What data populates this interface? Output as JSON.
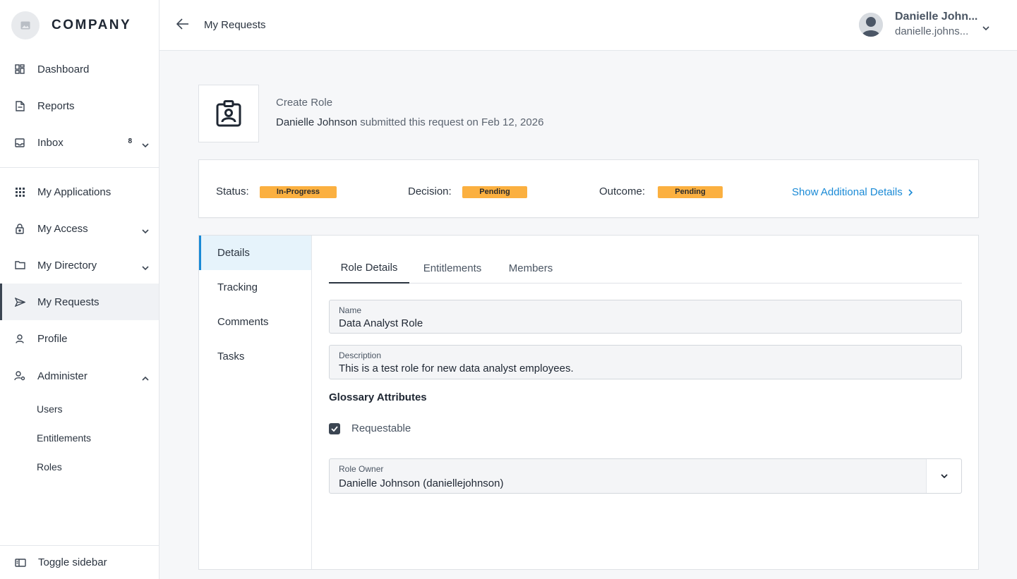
{
  "brand": {
    "name": "COMPANY"
  },
  "sidebar": {
    "items": [
      {
        "label": "Dashboard"
      },
      {
        "label": "Reports"
      },
      {
        "label": "Inbox",
        "badge": "8"
      },
      {
        "label": "My Applications"
      },
      {
        "label": "My Access"
      },
      {
        "label": "My Directory"
      },
      {
        "label": "My Requests"
      },
      {
        "label": "Profile"
      },
      {
        "label": "Administer"
      }
    ],
    "administer_sub": [
      {
        "label": "Users"
      },
      {
        "label": "Entitlements"
      },
      {
        "label": "Roles"
      }
    ],
    "toggle_label": "Toggle sidebar"
  },
  "header": {
    "title": "My Requests",
    "user_name": "Danielle John...",
    "user_email": "danielle.johns..."
  },
  "request": {
    "title": "Create Role",
    "submitter": "Danielle Johnson",
    "submitted_text": "submitted this request on Feb 12, 2026"
  },
  "status": {
    "status_label": "Status:",
    "status_value": "In-Progress",
    "decision_label": "Decision:",
    "decision_value": "Pending",
    "outcome_label": "Outcome:",
    "outcome_value": "Pending",
    "show_details": "Show Additional Details",
    "pill_color": "#fbb040"
  },
  "side_tabs": [
    {
      "label": "Details"
    },
    {
      "label": "Tracking"
    },
    {
      "label": "Comments"
    },
    {
      "label": "Tasks"
    }
  ],
  "tabs": [
    {
      "label": "Role Details"
    },
    {
      "label": "Entitlements"
    },
    {
      "label": "Members"
    }
  ],
  "form": {
    "name_label": "Name",
    "name_value": "Data Analyst Role",
    "description_label": "Description",
    "description_value": "This is a test role for new data analyst employees.",
    "glossary_title": "Glossary Attributes",
    "requestable_label": "Requestable",
    "owner_label": "Role Owner",
    "owner_value": "Danielle Johnson (daniellejohnson)"
  },
  "colors": {
    "accent": "#1a8ad6",
    "active_nav": "#f0f2f5",
    "active_tab_bg": "#e6f3fb"
  }
}
